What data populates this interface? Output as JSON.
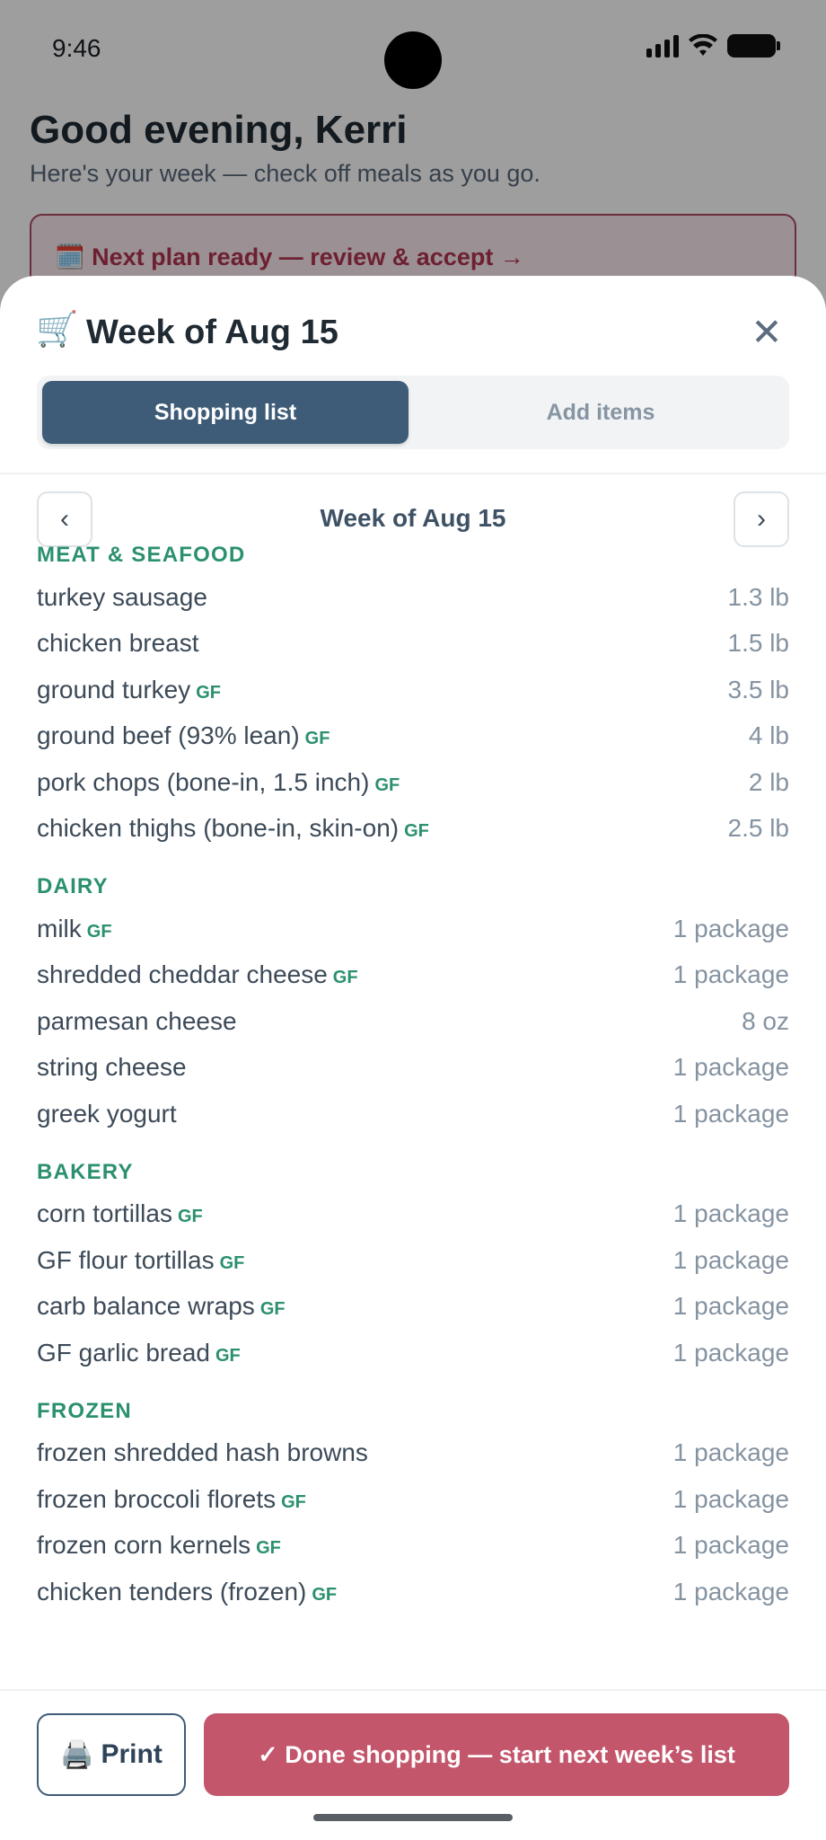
{
  "status": {
    "time": "9:46"
  },
  "background": {
    "greeting": "Good evening, Kerri",
    "subgreeting": "Here's your week — check off meals as you go.",
    "banner_icon": "🗓️",
    "banner_text": "Next plan ready — review & accept →"
  },
  "sheet": {
    "cart_icon": "🛒",
    "title": "Week of Aug 15",
    "close_icon": "✕",
    "tabs": [
      {
        "label": "Shopping list",
        "active": true
      },
      {
        "label": "Add items",
        "active": false
      }
    ],
    "week_nav": {
      "prev": "‹",
      "label": "Week of Aug 15",
      "next": "›"
    },
    "sections": [
      {
        "title": "MEAT & SEAFOOD",
        "items": [
          {
            "name": "turkey sausage",
            "gf": "",
            "qty": "1.3 lb"
          },
          {
            "name": "chicken breast",
            "gf": "",
            "qty": "1.5 lb"
          },
          {
            "name": "ground turkey",
            "gf": "GF",
            "qty": "3.5 lb"
          },
          {
            "name": "ground beef (93% lean)",
            "gf": "GF",
            "qty": "4 lb"
          },
          {
            "name": "pork chops (bone-in, 1.5 inch)",
            "gf": "GF",
            "qty": "2 lb"
          },
          {
            "name": "chicken thighs (bone-in, skin-on)",
            "gf": "GF",
            "qty": "2.5 lb"
          }
        ]
      },
      {
        "title": "DAIRY",
        "items": [
          {
            "name": "milk",
            "gf": "GF",
            "qty": "1 package"
          },
          {
            "name": "shredded cheddar cheese",
            "gf": "GF",
            "qty": "1 package"
          },
          {
            "name": "parmesan cheese",
            "gf": "",
            "qty": "8 oz"
          },
          {
            "name": "string cheese",
            "gf": "",
            "qty": "1 package"
          },
          {
            "name": "greek yogurt",
            "gf": "",
            "qty": "1 package"
          }
        ]
      },
      {
        "title": "BAKERY",
        "items": [
          {
            "name": "corn tortillas",
            "gf": "GF",
            "qty": "1 package"
          },
          {
            "name": "GF flour tortillas",
            "gf": "GF",
            "qty": "1 package"
          },
          {
            "name": "carb balance wraps",
            "gf": "GF",
            "qty": "1 package"
          },
          {
            "name": "GF garlic bread",
            "gf": "GF",
            "qty": "1 package"
          }
        ]
      },
      {
        "title": "FROZEN",
        "items": [
          {
            "name": "frozen shredded hash browns",
            "gf": "",
            "qty": "1 package"
          },
          {
            "name": "frozen broccoli florets",
            "gf": "GF",
            "qty": "1 package"
          },
          {
            "name": "frozen corn kernels",
            "gf": "GF",
            "qty": "1 package"
          },
          {
            "name": "chicken tenders (frozen)",
            "gf": "GF",
            "qty": "1 package"
          }
        ]
      }
    ],
    "footer": {
      "print_icon": "🖨️",
      "print_label": "Print",
      "done_label": "✓ Done shopping — start next week’s list"
    }
  }
}
